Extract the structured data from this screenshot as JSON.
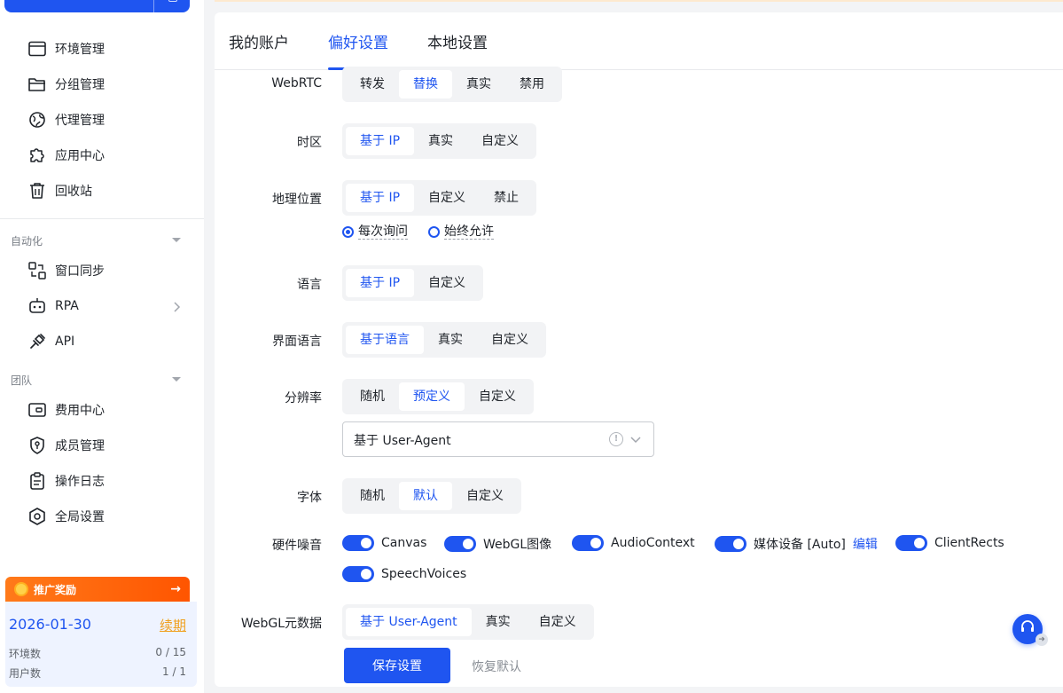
{
  "sidebar": {
    "nav": [
      {
        "label": "环境管理",
        "icon": "browser-window-icon"
      },
      {
        "label": "分组管理",
        "icon": "folder-icon"
      },
      {
        "label": "代理管理",
        "icon": "globe-icon"
      },
      {
        "label": "应用中心",
        "icon": "puzzle-icon"
      },
      {
        "label": "回收站",
        "icon": "trash-icon"
      }
    ],
    "automation": {
      "title": "自动化",
      "items": [
        {
          "label": "窗口同步",
          "icon": "sync-windows-icon"
        },
        {
          "label": "RPA",
          "icon": "robot-icon"
        },
        {
          "label": "API",
          "icon": "plug-icon"
        }
      ]
    },
    "team": {
      "title": "团队",
      "items": [
        {
          "label": "费用中心",
          "icon": "wallet-icon"
        },
        {
          "label": "成员管理",
          "icon": "shield-user-icon"
        },
        {
          "label": "操作日志",
          "icon": "clipboard-icon"
        },
        {
          "label": "全局设置",
          "icon": "hexagon-settings-icon"
        }
      ]
    },
    "promo": {
      "label": "推广奖励",
      "arrow": "→"
    },
    "plan": {
      "expiry": "2026-01-30",
      "renew": "续期",
      "env_label": "环境数",
      "env_value": "0 / 15",
      "user_label": "用户数",
      "user_value": "1 / 1"
    }
  },
  "tabs": [
    {
      "label": "我的账户"
    },
    {
      "label": "偏好设置",
      "active": true
    },
    {
      "label": "本地设置"
    }
  ],
  "settings": {
    "webrtc": {
      "label": "WebRTC",
      "options": [
        "转发",
        "替换",
        "真实",
        "禁用"
      ],
      "selected": 1
    },
    "timezone": {
      "label": "时区",
      "options": [
        "基于 IP",
        "真实",
        "自定义"
      ],
      "selected": 0
    },
    "geo": {
      "label": "地理位置",
      "options": [
        "基于 IP",
        "自定义",
        "禁止"
      ],
      "selected": 0,
      "radios": [
        {
          "label": "每次询问",
          "checked": true
        },
        {
          "label": "始终允许",
          "checked": false
        }
      ]
    },
    "language": {
      "label": "语言",
      "options": [
        "基于 IP",
        "自定义"
      ],
      "selected": 0
    },
    "ui_language": {
      "label": "界面语言",
      "options": [
        "基于语言",
        "真实",
        "自定义"
      ],
      "selected": 0
    },
    "resolution": {
      "label": "分辨率",
      "options": [
        "随机",
        "预定义",
        "自定义"
      ],
      "selected": 1,
      "select_value": "基于 User-Agent"
    },
    "fonts": {
      "label": "字体",
      "options": [
        "随机",
        "默认",
        "自定义"
      ],
      "selected": 1
    },
    "hardware_noise": {
      "label": "硬件噪音",
      "toggles": [
        "Canvas",
        "WebGL图像",
        "AudioContext",
        "媒体设备 [Auto]",
        "ClientRects",
        "SpeechVoices"
      ],
      "edit_label": "编辑"
    },
    "webgl_meta": {
      "label": "WebGL元数据",
      "options": [
        "基于 User-Agent",
        "真实",
        "自定义"
      ],
      "selected": 0
    }
  },
  "actions": {
    "save": "保存设置",
    "reset": "恢复默认"
  },
  "colors": {
    "accent": "#1f55f0",
    "promo": "#ff5500",
    "renew": "#f0a020"
  }
}
